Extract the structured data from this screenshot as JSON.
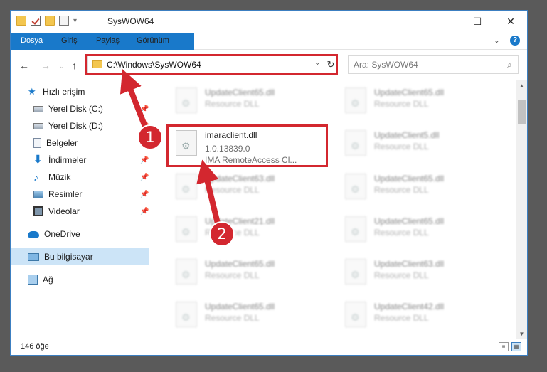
{
  "window": {
    "title": "SysWOW64",
    "controls": {
      "minimize": "—",
      "maximize": "☐",
      "close": "✕"
    }
  },
  "ribbon": {
    "tabs": [
      "Dosya",
      "Giriş",
      "Paylaş",
      "Görünüm"
    ],
    "expand": "⌄",
    "help": "?"
  },
  "nav": {
    "back": "←",
    "forward": "→",
    "up": "↑",
    "address": "C:\\Windows\\SysWOW64",
    "dropdown": "⌄",
    "refresh": "↻",
    "search_placeholder": "Ara: SysWOW64",
    "search_icon": "⌕"
  },
  "sidebar": {
    "items": [
      {
        "label": "Hızlı erişim",
        "icon": "star-icon"
      },
      {
        "label": "Yerel Disk (C:)",
        "icon": "disk-icon",
        "pinned": true
      },
      {
        "label": "Yerel Disk (D:)",
        "icon": "disk-icon",
        "pinned": true
      },
      {
        "label": "Belgeler",
        "icon": "document-icon",
        "pinned": true
      },
      {
        "label": "İndirmeler",
        "icon": "download-icon",
        "pinned": true
      },
      {
        "label": "Müzik",
        "icon": "music-icon",
        "pinned": true
      },
      {
        "label": "Resimler",
        "icon": "pictures-icon",
        "pinned": true
      },
      {
        "label": "Videolar",
        "icon": "video-icon",
        "pinned": true
      },
      {
        "label": "OneDrive",
        "icon": "cloud-icon"
      },
      {
        "label": "Bu bilgisayar",
        "icon": "computer-icon",
        "selected": true
      },
      {
        "label": "Ağ",
        "icon": "network-icon"
      }
    ],
    "pin_glyph": "📌"
  },
  "files": {
    "highlighted": {
      "name": "imaraclient.dll",
      "version": "1.0.13839.0",
      "description": "IMA RemoteAccess Cl..."
    },
    "left_column": [
      {
        "name": "UpdateClient65.dll",
        "type": "Resource DLL"
      },
      {
        "name": "UpdateClient63.dll",
        "type": "Resource DLL"
      },
      {
        "name": "UpdateClient21.dll",
        "type": "Resource DLL"
      },
      {
        "name": "UpdateClient65.dll",
        "type": "Resource DLL"
      },
      {
        "name": "UpdateClient65.dll",
        "type": "Resource DLL"
      }
    ],
    "right_column": [
      {
        "name": "UpdateClient65.dll",
        "type": "Resource DLL"
      },
      {
        "name": "UpdateClient5.dll",
        "type": "Resource DLL"
      },
      {
        "name": "UpdateClient65.dll",
        "type": "Resource DLL"
      },
      {
        "name": "UpdateClient65.dll",
        "type": "Resource DLL"
      },
      {
        "name": "UpdateClient63.dll",
        "type": "Resource DLL"
      },
      {
        "name": "UpdateClient42.dll",
        "type": "Resource DLL"
      }
    ]
  },
  "status": {
    "item_count": "146 öğe"
  },
  "annotations": {
    "step1": "1",
    "step2": "2",
    "color": "#d3272f"
  }
}
